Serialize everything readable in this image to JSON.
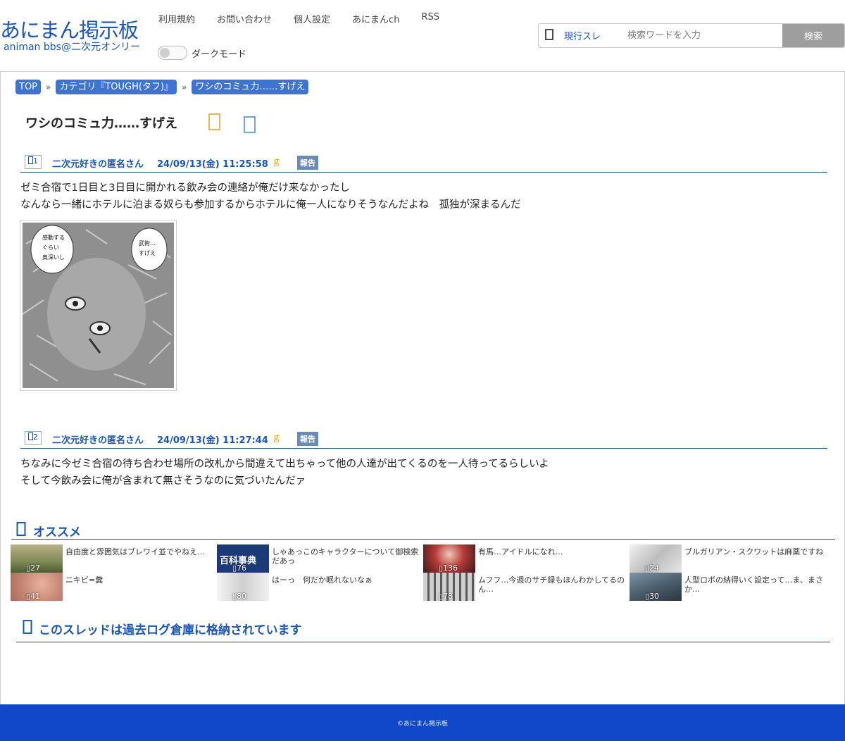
{
  "site": {
    "title": "あにまん掲示板",
    "subtitle": "animan bbs@二次元オンリー"
  },
  "nav": [
    "利用規約",
    "お問い合わせ",
    "個人設定",
    "あにまんch",
    "RSS"
  ],
  "darkmode": {
    "label": "ダークモード",
    "on": false
  },
  "search": {
    "icon": "search-icon",
    "scope": "現行スレ",
    "placeholder": "検索ワードを入力",
    "button": "検索"
  },
  "breadcrumb": [
    "TOP",
    "カテゴリ『TOUGH(タフ)』",
    "ワシのコミュ力……すげえ"
  ],
  "breadcrumb_sep": "»",
  "thread": {
    "title": "ワシのコミュ力……すげえ",
    "icons": [
      "bookmark-icon",
      "share-icon"
    ]
  },
  "posts": [
    {
      "num": "1",
      "name": "二次元好きの匿名さん",
      "date": "24/09/13(金) 11:25:58",
      "like": "ｇ",
      "report": "報告",
      "body": [
        "ゼミ合宿で1日目と3日目に開かれる飲み会の連絡が俺だけ来なかったし",
        "なんなら一緒にホテルに泊まる奴らも参加するからホテルに俺一人になりそうなんだよね　孤独が深まるんだ"
      ],
      "image_text": [
        "武術…すげえ",
        "感動するぐらい奥深いし"
      ]
    },
    {
      "num": "2",
      "name": "二次元好きの匿名さん",
      "date": "24/09/13(金) 11:27:44",
      "like": "ｇ",
      "report": "報告",
      "body": [
        "ちなみに今ゼミ合宿の待ち合わせ場所の改札から間違えて出ちゃって他の人達が出てくるのを一人待ってるらしいよ",
        "そして今飲み会に俺が含まれて無さそうなのに気づいたんだァ"
      ]
    }
  ],
  "recommend": {
    "label": "オススメ",
    "icon": "recommend-icon",
    "items": [
      {
        "title": "自由度と雰囲気はブレワイ並でやねえ…",
        "count": "27",
        "thumb_color": "#8a8a5c"
      },
      {
        "title": "しゃあっこのキャラクターについて御検索だあっ",
        "count": "76",
        "thumb_color": "#1d3a78",
        "thumb_text": "百科事典"
      },
      {
        "title": "有馬…アイドルになれ…",
        "count": "136",
        "thumb_color": "#7a2a2a"
      },
      {
        "title": "ブルガリアン・スクワットは麻薬ですね",
        "count": "24",
        "thumb_color": "#d9d9d9"
      },
      {
        "title": "ニキビ=糞",
        "count": "41",
        "thumb_color": "#c98a78"
      },
      {
        "title": "はーっ　何だか眠れないなぁ",
        "count": "80",
        "thumb_color": "#e0e0e0"
      },
      {
        "title": "ムフフ…今週のサチ録もほんわかしてるのん…",
        "count": "78",
        "thumb_color": "#9a9a9a"
      },
      {
        "title": "人型ロボの納得いく設定って…ま、まさか…",
        "count": "30",
        "thumb_color": "#4d5f6e"
      }
    ]
  },
  "archive": {
    "icon": "archive-icon",
    "label": "このスレッドは過去ログ倉庫に格納されています"
  },
  "footer": "©あにまん掲示板",
  "colors": {
    "brand": "#1a55b8",
    "footer": "#1048c9",
    "crumb": "#3f73d2",
    "report": "#6a8bb8"
  }
}
